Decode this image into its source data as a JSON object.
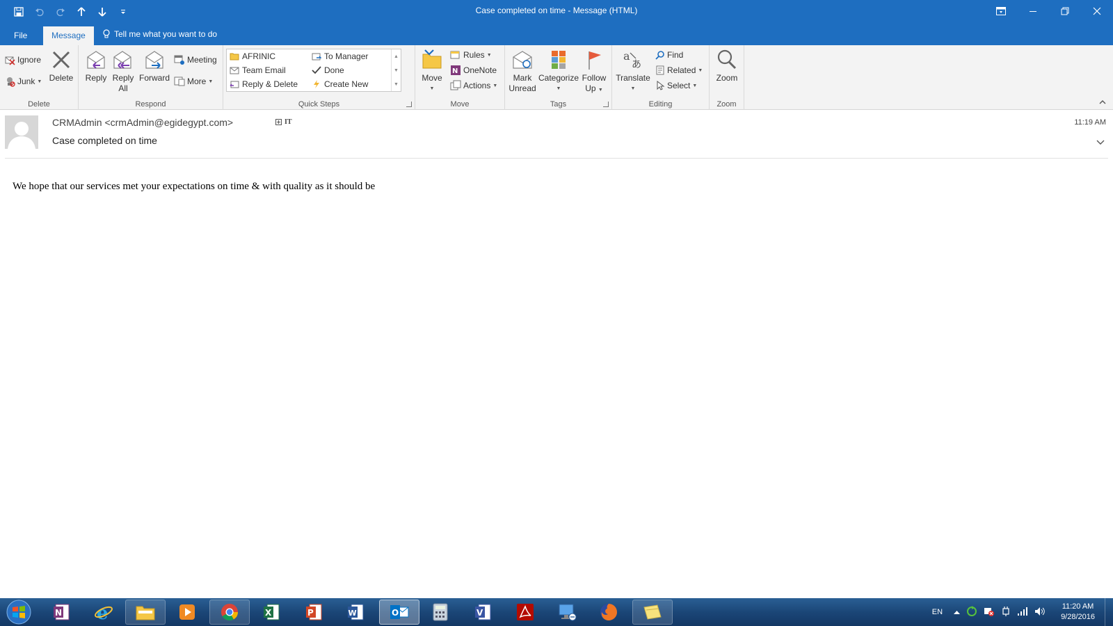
{
  "window": {
    "title": "Case completed on time - Message (HTML)"
  },
  "tabs": {
    "file": "File",
    "message": "Message",
    "tell_me": "Tell me what you want to do"
  },
  "ribbon": {
    "delete_group": {
      "label": "Delete",
      "ignore": "Ignore",
      "junk": "Junk",
      "delete": "Delete"
    },
    "respond_group": {
      "label": "Respond",
      "reply": "Reply",
      "reply_all_1": "Reply",
      "reply_all_2": "All",
      "forward": "Forward",
      "meeting": "Meeting",
      "more": "More"
    },
    "quick_steps_group": {
      "label": "Quick Steps",
      "items": [
        "AFRINIC",
        "Team Email",
        "Reply & Delete",
        "To Manager",
        "Done",
        "Create New"
      ]
    },
    "move_group": {
      "label": "Move",
      "move": "Move",
      "rules": "Rules",
      "onenote": "OneNote",
      "actions": "Actions"
    },
    "tags_group": {
      "label": "Tags",
      "mark_unread_1": "Mark",
      "mark_unread_2": "Unread",
      "categorize": "Categorize",
      "follow_up_1": "Follow",
      "follow_up_2": "Up"
    },
    "editing_group": {
      "label": "Editing",
      "translate": "Translate",
      "find": "Find",
      "related": "Related",
      "select": "Select"
    },
    "zoom_group": {
      "label": "Zoom",
      "zoom": "Zoom"
    }
  },
  "message": {
    "sender": "CRMAdmin <crmAdmin@egidegypt.com>",
    "category": "IT",
    "subject": "Case completed on time",
    "time": "11:19 AM",
    "body": "We hope that our services met your expectations on time & with quality as it should be"
  },
  "taskbar": {
    "apps": [
      "onenote-icon",
      "internet-explorer-icon",
      "file-explorer-icon",
      "media-player-icon",
      "chrome-icon",
      "excel-icon",
      "powerpoint-icon",
      "word-icon",
      "outlook-icon",
      "calculator-icon",
      "visio-icon",
      "acrobat-icon",
      "remote-desktop-icon",
      "firefox-icon",
      "sticky-notes-icon"
    ],
    "language": "EN",
    "time": "11:20 AM",
    "date": "9/28/2016"
  },
  "colors": {
    "accent": "#1e6ec0",
    "ribbon_bg": "#f3f3f3",
    "taskbar": "#1b4677"
  }
}
